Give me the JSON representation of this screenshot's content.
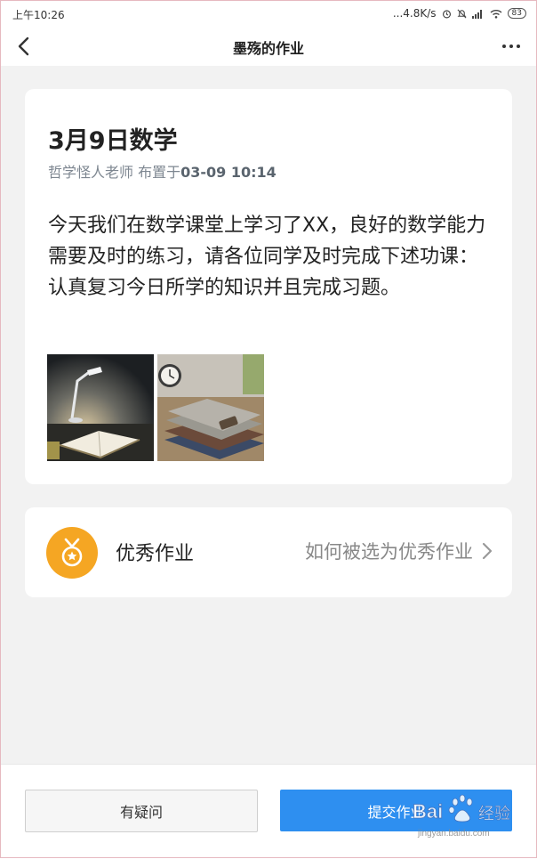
{
  "status_bar": {
    "time": "上午10:26",
    "network_speed": "...4.8K/s",
    "battery": "83"
  },
  "nav": {
    "title": "墨殇的作业"
  },
  "homework": {
    "title": "3月9日数学",
    "teacher": "哲学怪人老师",
    "assigned_prefix": "布置于",
    "assigned_time": "03-09 10:14",
    "content": "今天我们在数学课堂上学习了XX，良好的数学能力需要及时的练习，请各位同学及时完成下述功课：认真复习今日所学的知识并且完成习题。",
    "images": [
      "desk-lamp-with-open-book",
      "notebooks-and-clock"
    ]
  },
  "excellent": {
    "label": "优秀作业",
    "link": "如何被选为优秀作业"
  },
  "actions": {
    "question": "有疑问",
    "submit": "提交作业"
  },
  "watermark": {
    "brand": "Bai",
    "brand2": "经验",
    "url": "jingyan.baidu.com"
  },
  "colors": {
    "primary": "#2e8ff0",
    "medal": "#f5a623"
  }
}
